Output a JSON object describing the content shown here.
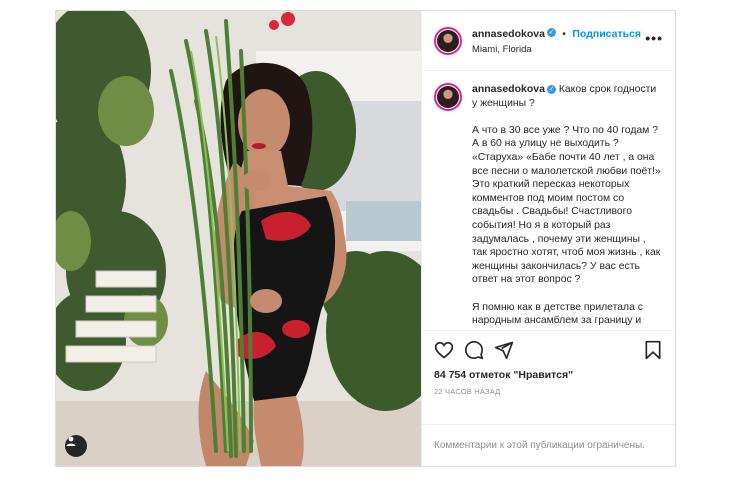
{
  "post": {
    "username": "annasedokova",
    "follow_label": "Подписаться",
    "separator": "•",
    "location": "Miami, Florida",
    "caption_first": "Каков срок годности у женщины ?",
    "caption_paragraphs": [
      "А что в 30 все уже ? Что по 40 годам ? А в 60 на улицу не выходить ? «Старуха» «Бабе почти 40 лет , а она все песни о малолетской любви поёт!» Это краткий пересказ некоторых комментов под моим постом со свадьбы . Свадьбы! Счастливого события! Но я в который раз задумалась , почему эти женщины , так яростно хотят, чтоб моя жизнь , как женщины закончилась? У вас есть ответ на этот вопрос ?",
      "Я помню как в детстве прилетала с народным ансамблем за границу и видела таких красивых женщин за"
    ],
    "likes_text": "84 754 отметок \"Нравится\"",
    "time_text": "22 часов назад",
    "comments_limited": "Комментарии к этой публикации ограничены."
  },
  "icons": {
    "verified": "verified-badge",
    "more": "more-options-icon",
    "like": "heart-icon",
    "comment": "comment-icon",
    "share": "share-icon",
    "save": "bookmark-icon",
    "tag": "user-tag-icon"
  },
  "colors": {
    "link": "#0095f6",
    "verified": "#3897f0",
    "text": "#262626",
    "muted": "#8e8e8e",
    "border": "#dbdbdb"
  }
}
